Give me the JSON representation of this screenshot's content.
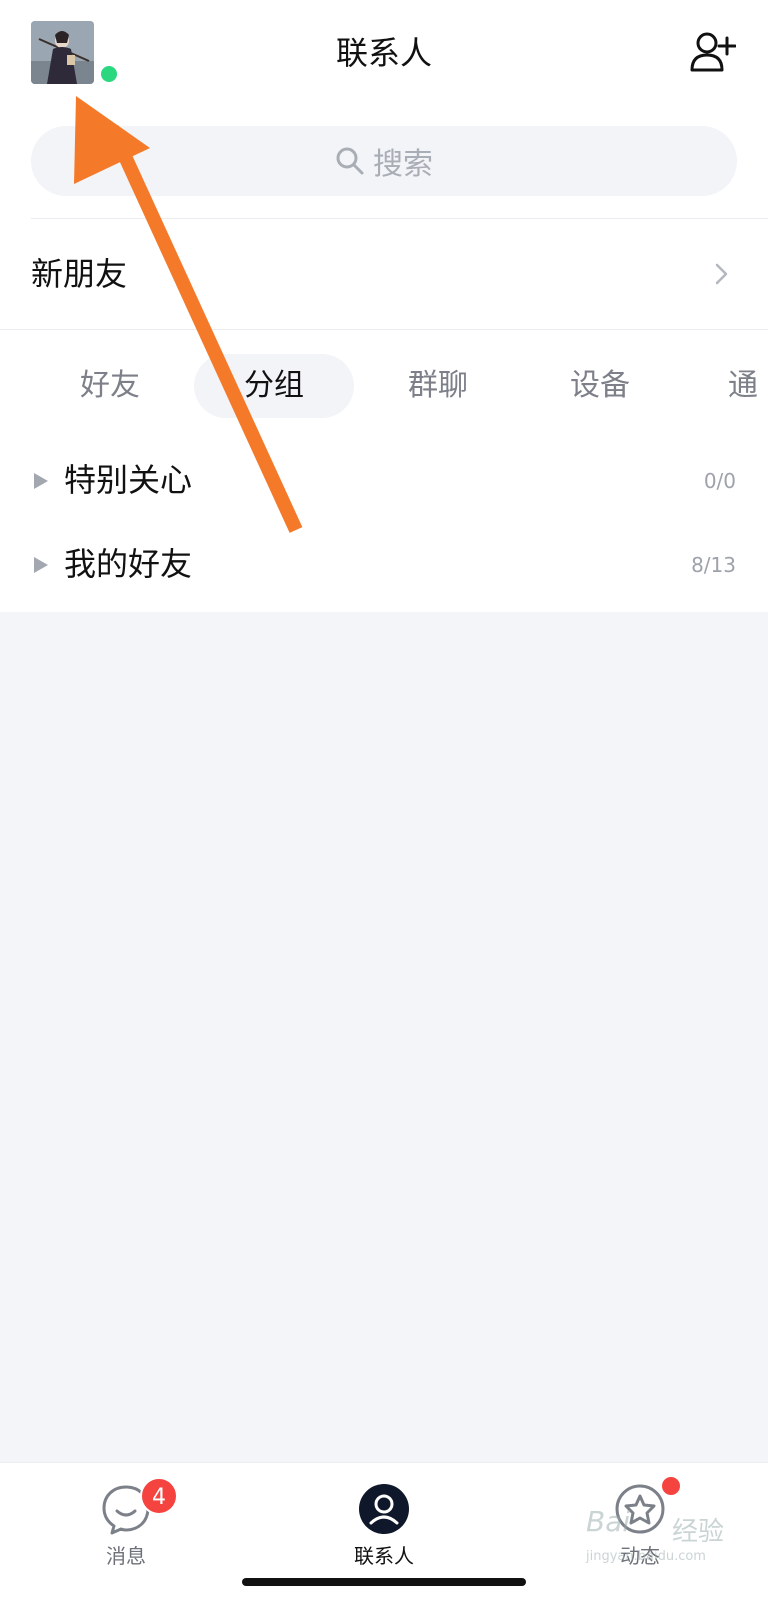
{
  "header": {
    "title": "联系人",
    "online_status_color": "#2bd880",
    "avatar_icon": "user-avatar-photo",
    "add_contact_icon": "add-person-icon"
  },
  "search": {
    "placeholder": "搜索",
    "icon": "search-icon"
  },
  "new_friends": {
    "label": "新朋友"
  },
  "tabs": [
    {
      "label": "好友",
      "active": false
    },
    {
      "label": "分组",
      "active": true
    },
    {
      "label": "群聊",
      "active": false
    },
    {
      "label": "设备",
      "active": false
    },
    {
      "label": "通",
      "active": false
    }
  ],
  "groups": [
    {
      "name": "特别关心",
      "count": "0/0"
    },
    {
      "name": "我的好友",
      "count": "8/13"
    }
  ],
  "bottom_nav": [
    {
      "label": "消息",
      "icon": "chat-bubble-icon",
      "badge": "4",
      "active": false
    },
    {
      "label": "联系人",
      "icon": "contacts-icon",
      "active": true
    },
    {
      "label": "动态",
      "icon": "star-circle-icon",
      "dot": true,
      "active": false
    }
  ],
  "annotation": {
    "color": "#f47a2a"
  },
  "watermark": {
    "logo": "Bai",
    "text": "经验",
    "url": "jingyan.baidu.com"
  },
  "colors": {
    "accent_dark": "#0f172a",
    "badge_red": "#f5443f",
    "page_bg": "#f4f5f9"
  }
}
